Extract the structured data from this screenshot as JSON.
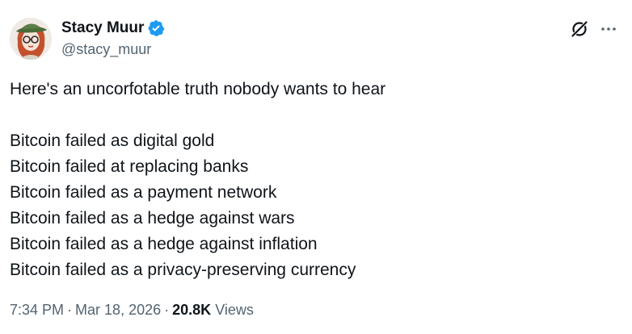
{
  "author": {
    "display_name": "Stacy Muur",
    "handle": "@stacy_muur",
    "verified": true,
    "verified_color": "#1d9bf0"
  },
  "icons": {
    "avatar": "avatar-illustration",
    "verified": "verified-badge-icon",
    "grok": "grok-icon",
    "more": "more-options-icon"
  },
  "tweet": {
    "intro": "Here's an uncorfotable truth nobody wants to hear",
    "lines": [
      "Bitcoin failed as digital gold",
      "Bitcoin failed at replacing banks",
      "Bitcoin failed as a payment network",
      "Bitcoin failed as a hedge against wars",
      "Bitcoin failed as a hedge against inflation",
      "Bitcoin failed as a privacy-preserving currency"
    ]
  },
  "meta": {
    "time": "7:34 PM",
    "separator": "·",
    "date": "Mar 18, 2026",
    "views_count": "20.8K",
    "views_label": "Views"
  },
  "colors": {
    "text_primary": "#0f1419",
    "text_secondary": "#536471",
    "background": "#ffffff"
  }
}
